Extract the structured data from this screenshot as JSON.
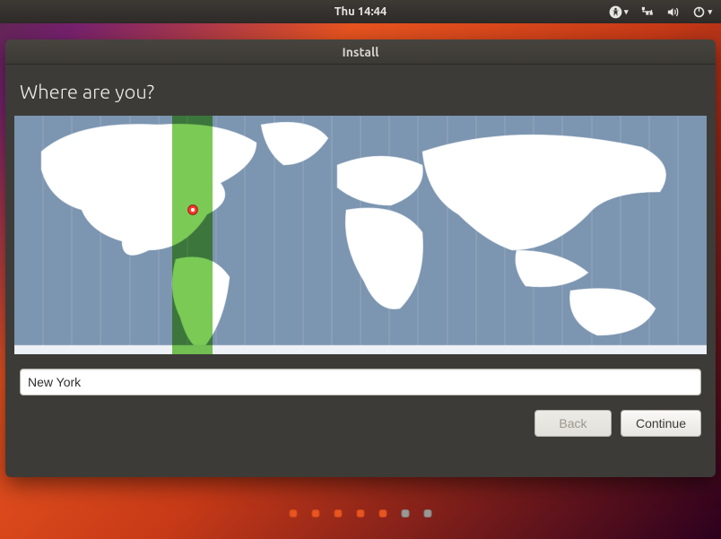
{
  "topbar": {
    "clock": "Thu 14:44"
  },
  "window": {
    "title": "Install",
    "heading": "Where are you?"
  },
  "timezone": {
    "input_value": "New York",
    "highlight_band": {
      "left_pct": 22.8,
      "width_pct": 5.8
    },
    "pin": {
      "x_pct": 25.8,
      "y_pct": 39.5
    }
  },
  "buttons": {
    "back": "Back",
    "continue": "Continue"
  },
  "progress": {
    "total": 7,
    "current": 5
  }
}
